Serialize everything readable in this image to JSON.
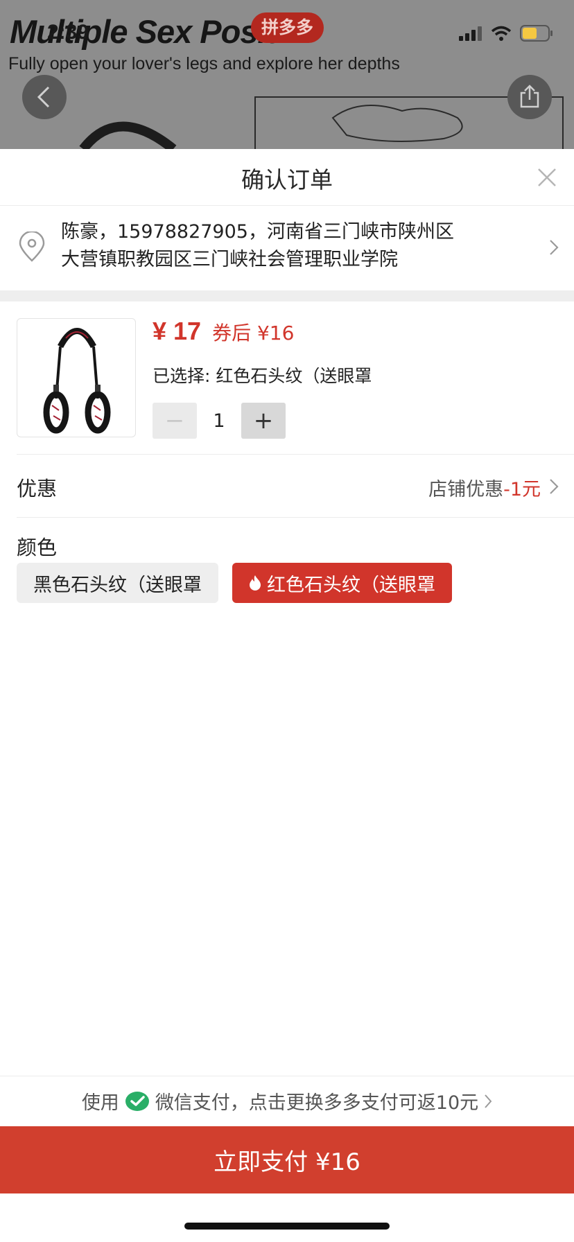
{
  "status_bar": {
    "time": "2:39"
  },
  "background_page": {
    "title": "Multiple Sex Posit",
    "subtitle": "Fully open your lover's legs and explore her depths",
    "badge": "拼多多"
  },
  "sheet": {
    "title": "确认订单",
    "address": {
      "line1": "陈豪，15978827905，河南省三门峡市陕州区",
      "line2": "大营镇职教园区三门峡社会管理职业学院"
    },
    "product": {
      "price": "¥ 17",
      "coupon_price": "券后 ¥16",
      "selected": "已选择: 红色石头纹（送眼罩",
      "quantity": "1",
      "minus": "−",
      "plus": "+"
    },
    "discount": {
      "label": "优惠",
      "value_prefix": "店铺优惠",
      "value_amount": "-1元"
    },
    "color": {
      "label": "颜色",
      "options": [
        {
          "label": "黑色石头纹（送眼罩",
          "selected": false
        },
        {
          "label": "红色石头纹（送眼罩",
          "selected": true
        }
      ]
    }
  },
  "footer": {
    "pay_hint_use": "使用",
    "pay_hint_method": "微信支付，点击更换多多支付可返10元",
    "pay_button": "立即支付 ¥16"
  },
  "colors": {
    "accent_red": "#d1352b",
    "pay_button": "#d13f2e",
    "wechat_green": "#2aae67"
  },
  "icons": [
    "back-icon",
    "share-icon",
    "close-icon",
    "location-pin-icon",
    "chevron-right-icon",
    "flame-icon",
    "wechat-pay-icon",
    "signal-icon",
    "wifi-icon",
    "battery-icon"
  ]
}
